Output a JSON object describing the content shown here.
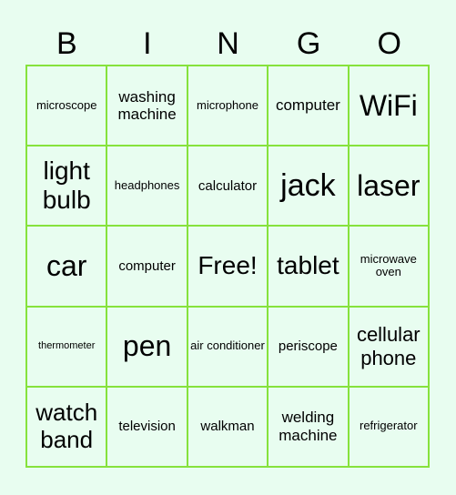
{
  "header": [
    "B",
    "I",
    "N",
    "G",
    "O"
  ],
  "cells": [
    [
      "microscope",
      "washing machine",
      "microphone",
      "computer",
      "WiFi"
    ],
    [
      "light bulb",
      "headphones",
      "calculator",
      "jack",
      "laser"
    ],
    [
      "car",
      "computer",
      "Free!",
      "tablet",
      "microwave oven"
    ],
    [
      "thermometer",
      "pen",
      "air conditioner",
      "periscope",
      "cellular phone"
    ],
    [
      "watch band",
      "television",
      "walkman",
      "welding machine",
      "refrigerator"
    ]
  ],
  "colors": {
    "grid_line": "#86e23c",
    "background": "#e8fdf0"
  }
}
